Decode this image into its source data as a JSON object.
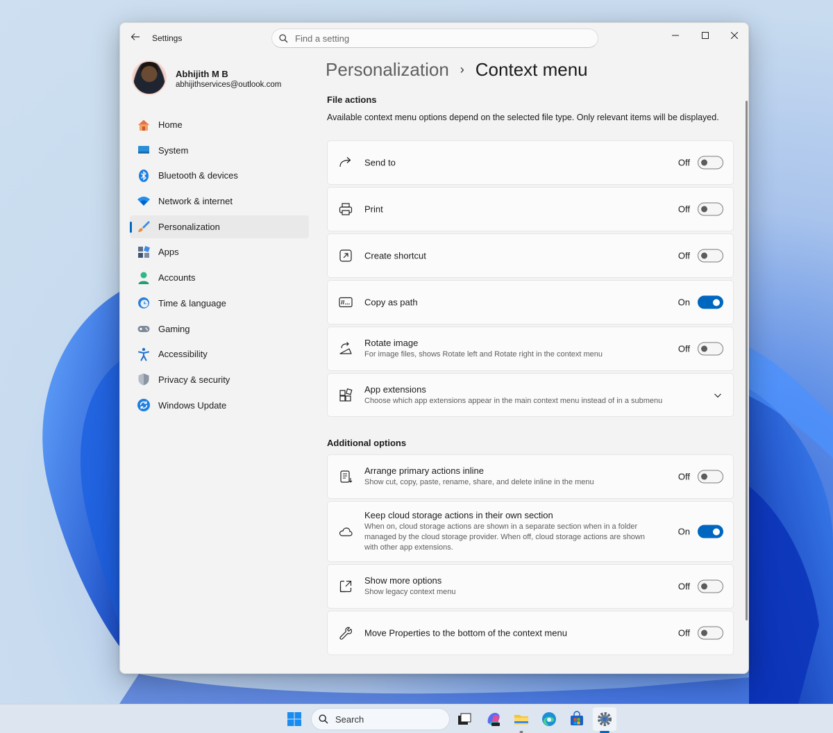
{
  "window": {
    "app_title": "Settings",
    "search_placeholder": "Find a setting"
  },
  "user": {
    "name": "Abhijith M B",
    "email": "abhijithservices@outlook.com"
  },
  "sidebar": {
    "items": [
      {
        "label": "Home",
        "icon": "home-icon"
      },
      {
        "label": "System",
        "icon": "system-icon"
      },
      {
        "label": "Bluetooth & devices",
        "icon": "bluetooth-icon"
      },
      {
        "label": "Network & internet",
        "icon": "wifi-icon"
      },
      {
        "label": "Personalization",
        "icon": "brush-icon",
        "active": true
      },
      {
        "label": "Apps",
        "icon": "apps-icon"
      },
      {
        "label": "Accounts",
        "icon": "accounts-icon"
      },
      {
        "label": "Time & language",
        "icon": "time-language-icon"
      },
      {
        "label": "Gaming",
        "icon": "gaming-icon"
      },
      {
        "label": "Accessibility",
        "icon": "accessibility-icon"
      },
      {
        "label": "Privacy & security",
        "icon": "shield-icon"
      },
      {
        "label": "Windows Update",
        "icon": "update-icon"
      }
    ]
  },
  "breadcrumb": {
    "parent": "Personalization",
    "separator": "›",
    "current": "Context menu"
  },
  "file_actions": {
    "title": "File actions",
    "description": "Available context menu options depend on the selected file type. Only relevant items will be displayed.",
    "items": [
      {
        "title": "Send to",
        "description": "",
        "state": "Off",
        "on": false,
        "icon": "send-to-icon"
      },
      {
        "title": "Print",
        "description": "",
        "state": "Off",
        "on": false,
        "icon": "printer-icon"
      },
      {
        "title": "Create shortcut",
        "description": "",
        "state": "Off",
        "on": false,
        "icon": "shortcut-icon"
      },
      {
        "title": "Copy as path",
        "description": "",
        "state": "On",
        "on": true,
        "icon": "copy-path-icon"
      },
      {
        "title": "Rotate image",
        "description": "For image files, shows Rotate left and Rotate right in the context menu",
        "state": "Off",
        "on": false,
        "icon": "rotate-icon"
      },
      {
        "title": "App extensions",
        "description": "Choose which app extensions appear in the main context menu instead of in a submenu",
        "expandable": true,
        "icon": "extensions-icon"
      }
    ]
  },
  "additional_options": {
    "title": "Additional options",
    "items": [
      {
        "title": "Arrange primary actions inline",
        "description": "Show cut, copy, paste, rename, share, and delete inline in the menu",
        "state": "Off",
        "on": false,
        "icon": "arrange-icon"
      },
      {
        "title": "Keep cloud storage actions in their own section",
        "description": "When on, cloud storage actions are shown in a separate section when in a folder managed by the cloud storage provider. When off, cloud storage actions are shown with other app extensions.",
        "state": "On",
        "on": true,
        "icon": "cloud-icon"
      },
      {
        "title": "Show more options",
        "description": "Show legacy context menu",
        "state": "Off",
        "on": false,
        "icon": "expand-icon"
      },
      {
        "title": "Move Properties to the bottom of the context menu",
        "description": "",
        "state": "Off",
        "on": false,
        "icon": "wrench-icon"
      }
    ]
  },
  "taskbar": {
    "search_label": "Search",
    "apps": [
      "start-icon",
      "task-view-icon",
      "m365-icon",
      "file-explorer-icon",
      "edge-icon",
      "store-icon",
      "settings-icon"
    ]
  },
  "colors": {
    "accent": "#0067c0",
    "window_bg": "#f3f3f3",
    "card_bg": "#fbfbfb"
  }
}
